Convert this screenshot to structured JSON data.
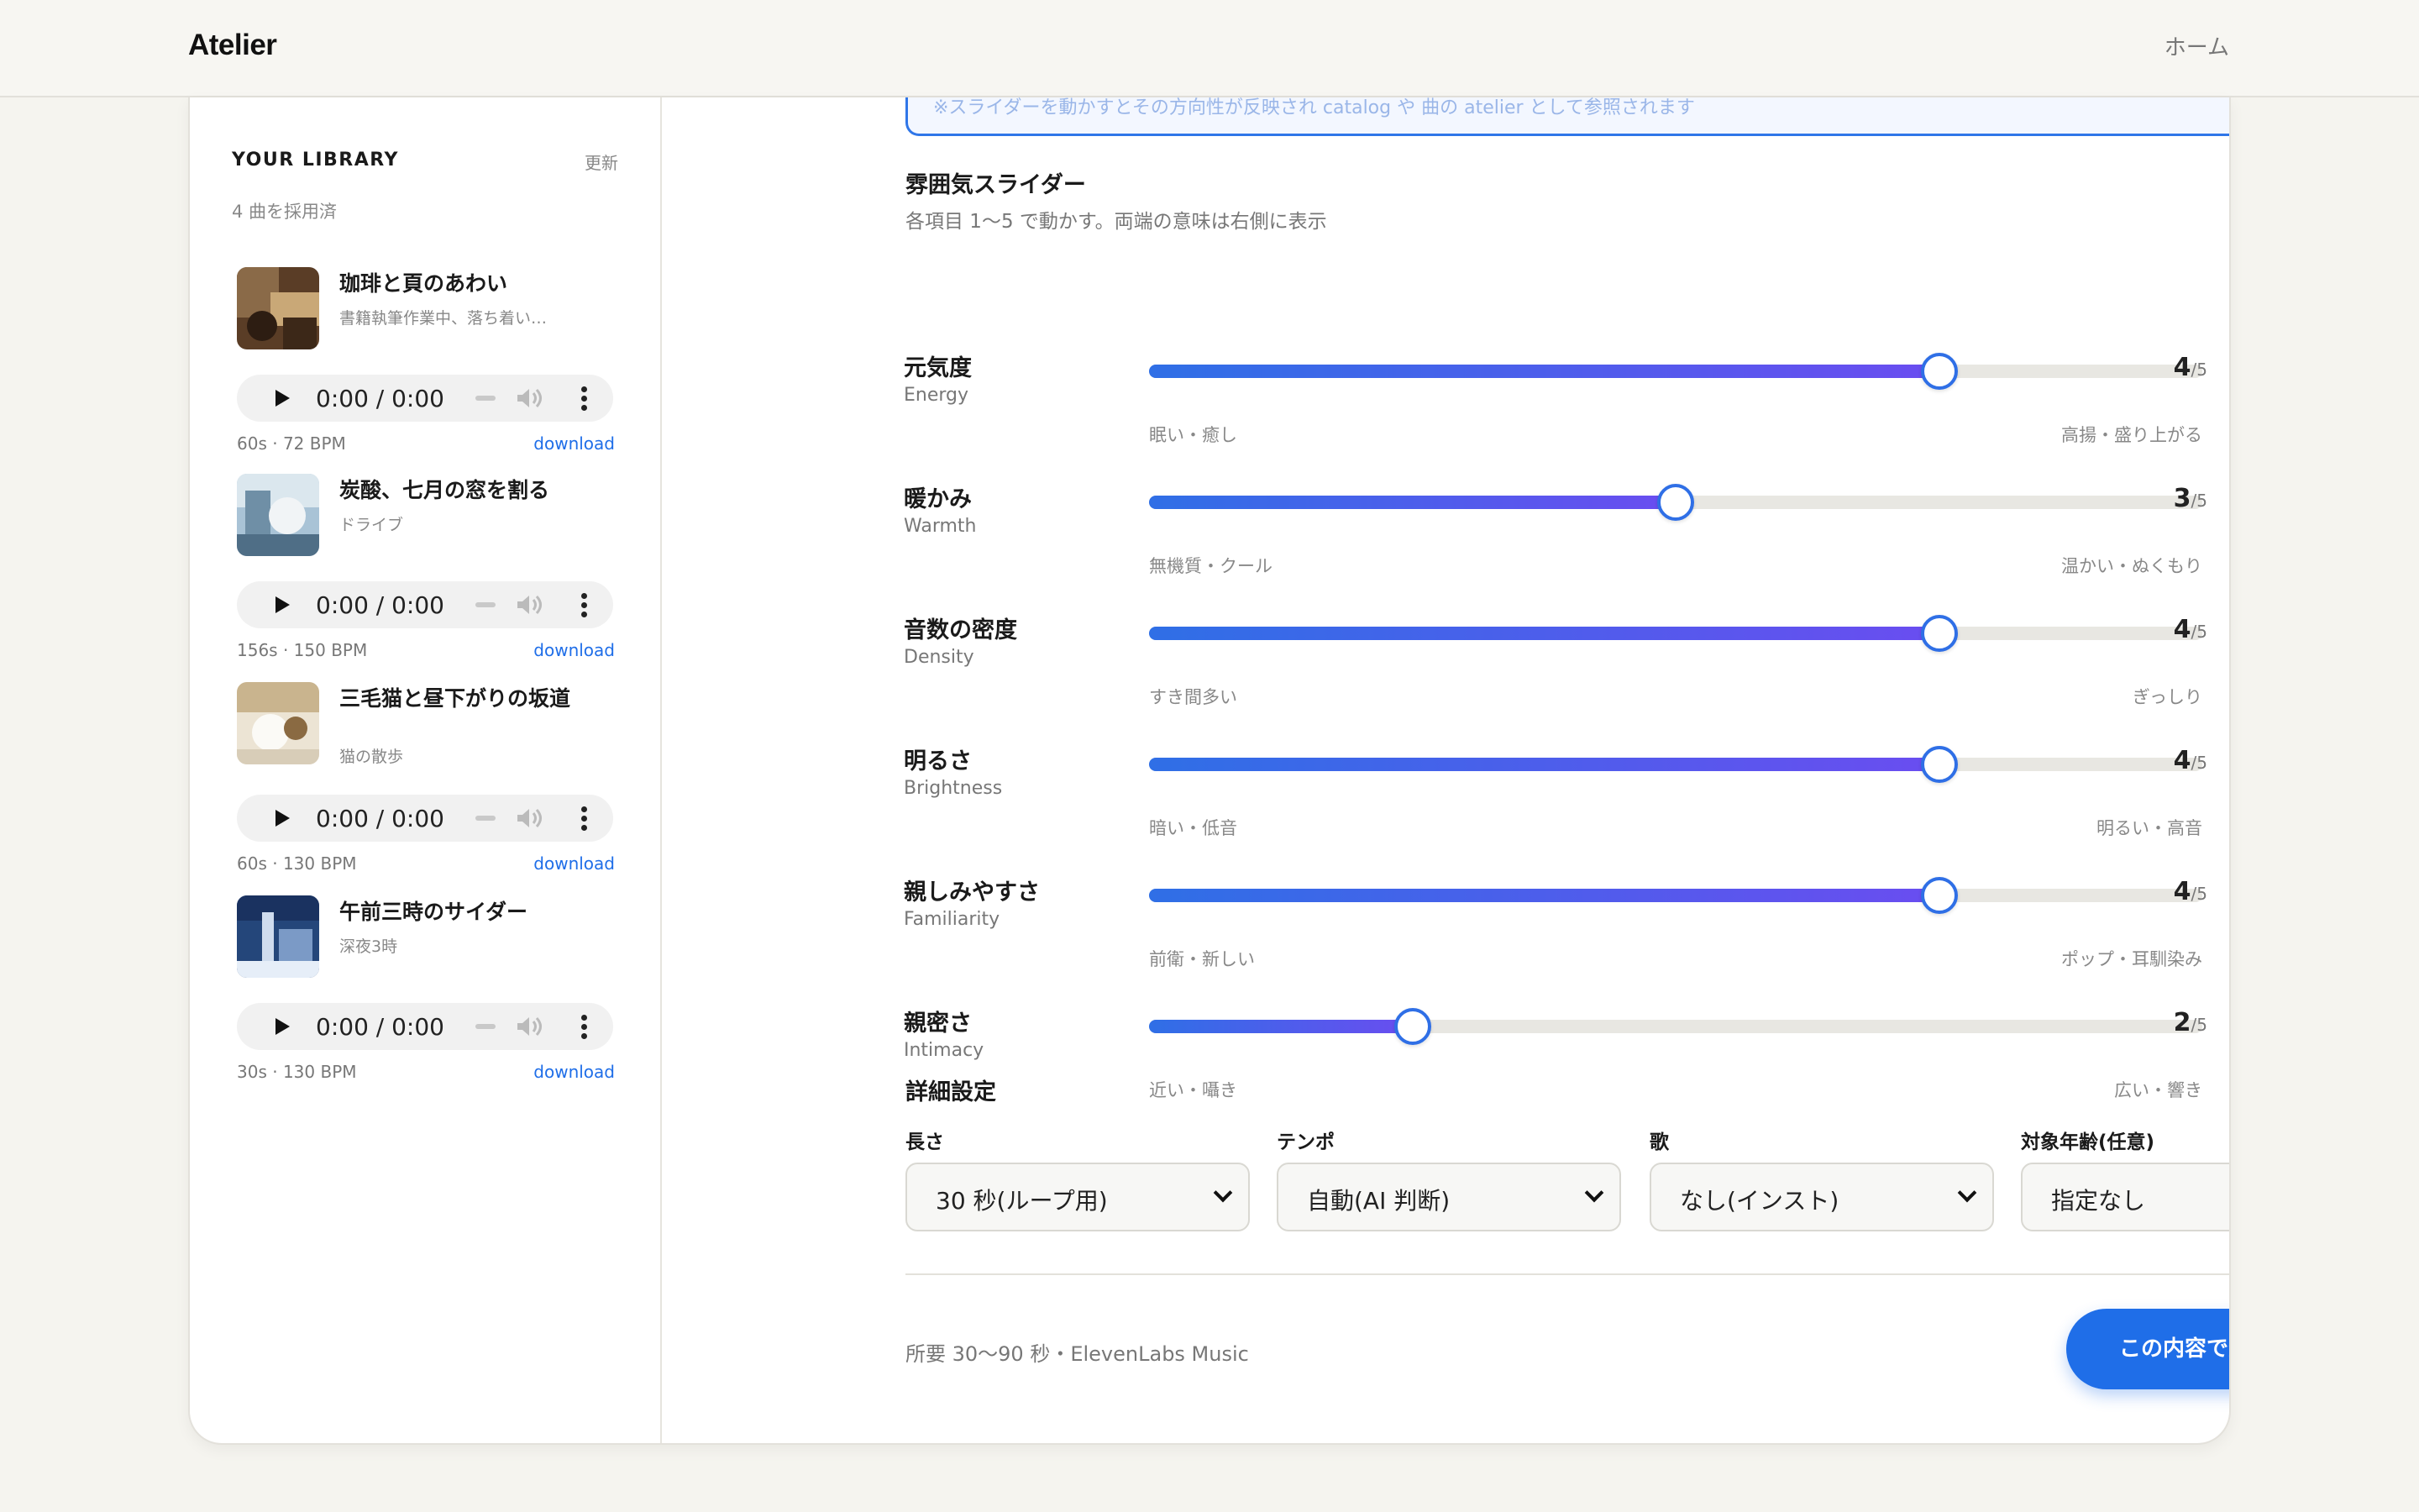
{
  "header": {
    "logo": "Atelier",
    "nav_home": "ホーム"
  },
  "library": {
    "title": "YOUR LIBRARY",
    "refresh": "更新",
    "count": "4 曲を採用済",
    "tracks": [
      {
        "title": "珈琲と頁のあわい",
        "subtitle": "書籍執筆作業中、落ち着い…",
        "time": "0:00 / 0:00",
        "meta": "60s · 72 BPM",
        "download": "download"
      },
      {
        "title": "炭酸、七月の窓を割る",
        "subtitle": "ドライブ",
        "time": "0:00 / 0:00",
        "meta": "156s · 150 BPM",
        "download": "download"
      },
      {
        "title": "三毛猫と昼下がりの坂道",
        "subtitle": "猫の散歩",
        "time": "0:00 / 0:00",
        "meta": "60s · 130 BPM",
        "download": "download"
      },
      {
        "title": "午前三時のサイダー",
        "subtitle": "深夜3時",
        "time": "0:00 / 0:00",
        "meta": "30s · 130 BPM",
        "download": "download"
      }
    ]
  },
  "notice": {
    "text": "※スライダーを動かすとその方向性が反映され catalog や 曲の atelier として参照されます"
  },
  "mood": {
    "title": "雰囲気スライダー",
    "description": "各項目 1〜5 で動かす。両端の意味は右側に表示",
    "max": "/5",
    "sliders": [
      {
        "label": "元気度",
        "sub": "Energy",
        "value": 4,
        "value_text": "4",
        "min_label": "眠い・癒し",
        "max_label": "高揚・盛り上がる"
      },
      {
        "label": "暖かみ",
        "sub": "Warmth",
        "value": 3,
        "value_text": "3",
        "min_label": "無機質・クール",
        "max_label": "温かい・ぬくもり"
      },
      {
        "label": "音数の密度",
        "sub": "Density",
        "value": 4,
        "value_text": "4",
        "min_label": "すき間多い",
        "max_label": "ぎっしり"
      },
      {
        "label": "明るさ",
        "sub": "Brightness",
        "value": 4,
        "value_text": "4",
        "min_label": "暗い・低音",
        "max_label": "明るい・高音"
      },
      {
        "label": "親しみやすさ",
        "sub": "Familiarity",
        "value": 4,
        "value_text": "4",
        "min_label": "前衛・新しい",
        "max_label": "ポップ・耳馴染み"
      },
      {
        "label": "親密さ",
        "sub": "Intimacy",
        "value": 2,
        "value_text": "2",
        "min_label": "近い・囁き",
        "max_label": "広い・響き"
      }
    ]
  },
  "details": {
    "title": "詳細設定",
    "fields": [
      {
        "label": "長さ",
        "value": "30 秒(ループ用)"
      },
      {
        "label": "テンポ",
        "value": "自動(AI 判断)"
      },
      {
        "label": "歌",
        "value": "なし(インスト)"
      },
      {
        "label": "対象年齢(任意)",
        "value": "指定なし"
      }
    ]
  },
  "footer": {
    "note": "所要 30〜90 秒・ElevenLabs Music",
    "generate": "この内容で生成する"
  },
  "colors": {
    "accent": "#1f6ee8",
    "accent2": "#6a4df0",
    "track_bg": "#e8e7e2"
  }
}
